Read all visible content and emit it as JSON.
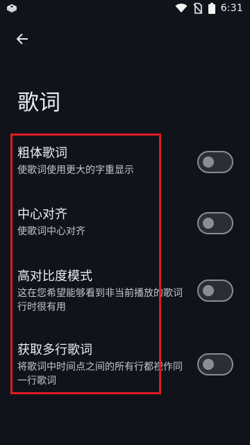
{
  "status_bar": {
    "time": "6:31",
    "left_icon": "app-notification-icon",
    "icons": [
      "wifi-icon",
      "no-sim-icon",
      "battery-icon"
    ]
  },
  "toolbar": {
    "back_icon": "back-arrow-icon"
  },
  "page": {
    "title": "歌词"
  },
  "settings": [
    {
      "title": "粗体歌词",
      "desc": "使歌词使用更大的字重显示",
      "enabled": false
    },
    {
      "title": "中心对齐",
      "desc": "使歌词中心对齐",
      "enabled": false
    },
    {
      "title": "高对比度模式",
      "desc": "这在您希望能够看到非当前播放的歌词行时很有用",
      "enabled": false
    },
    {
      "title": "获取多行歌词",
      "desc": "将歌词中时间点之间的所有行都视作同一行歌词",
      "enabled": false
    }
  ],
  "colors": {
    "background": "#101319",
    "highlight": "#e01b24",
    "toggle_outline": "#8a8d93"
  }
}
